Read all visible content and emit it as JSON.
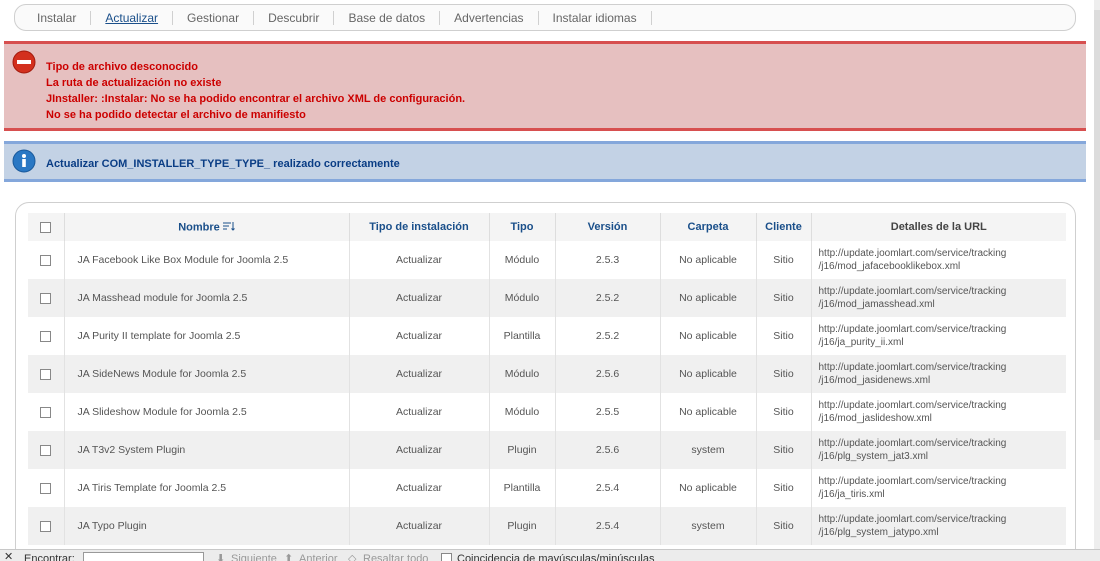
{
  "tabs": [
    "Instalar",
    "Actualizar",
    "Gestionar",
    "Descubrir",
    "Base de datos",
    "Advertencias",
    "Instalar idiomas"
  ],
  "active_tab": "Actualizar",
  "error_messages": [
    "Tipo de archivo desconocido",
    "La ruta de actualización no existe",
    "JInstaller: :Instalar: No se ha podido encontrar el archivo XML de configuración.",
    "No se ha podido detectar el archivo de manifiesto"
  ],
  "info_message": "Actualizar COM_INSTALLER_TYPE_TYPE_ realizado correctamente",
  "table": {
    "headers": {
      "nombre": "Nombre",
      "tipo_instalacion": "Tipo de instalación",
      "tipo": "Tipo",
      "version": "Versión",
      "carpeta": "Carpeta",
      "cliente": "Cliente",
      "detalles_url": "Detalles de la URL"
    },
    "rows": [
      {
        "name": "JA Facebook Like Box Module for Joomla 2.5",
        "install_type": "Actualizar",
        "type": "Módulo",
        "version": "2.5.3",
        "folder": "No aplicable",
        "client": "Sitio",
        "url1": "http://update.joomlart.com/service/tracking",
        "url2": "/j16/mod_jafacebooklikebox.xml"
      },
      {
        "name": "JA Masshead module for Joomla 2.5",
        "install_type": "Actualizar",
        "type": "Módulo",
        "version": "2.5.2",
        "folder": "No aplicable",
        "client": "Sitio",
        "url1": "http://update.joomlart.com/service/tracking",
        "url2": "/j16/mod_jamasshead.xml"
      },
      {
        "name": "JA Purity II template for Joomla 2.5",
        "install_type": "Actualizar",
        "type": "Plantilla",
        "version": "2.5.2",
        "folder": "No aplicable",
        "client": "Sitio",
        "url1": "http://update.joomlart.com/service/tracking",
        "url2": "/j16/ja_purity_ii.xml"
      },
      {
        "name": "JA SideNews Module for Joomla 2.5",
        "install_type": "Actualizar",
        "type": "Módulo",
        "version": "2.5.6",
        "folder": "No aplicable",
        "client": "Sitio",
        "url1": "http://update.joomlart.com/service/tracking",
        "url2": "/j16/mod_jasidenews.xml"
      },
      {
        "name": "JA Slideshow Module for Joomla 2.5",
        "install_type": "Actualizar",
        "type": "Módulo",
        "version": "2.5.5",
        "folder": "No aplicable",
        "client": "Sitio",
        "url1": "http://update.joomlart.com/service/tracking",
        "url2": "/j16/mod_jaslideshow.xml"
      },
      {
        "name": "JA T3v2 System Plugin",
        "install_type": "Actualizar",
        "type": "Plugin",
        "version": "2.5.6",
        "folder": "system",
        "client": "Sitio",
        "url1": "http://update.joomlart.com/service/tracking",
        "url2": "/j16/plg_system_jat3.xml"
      },
      {
        "name": "JA Tiris Template for Joomla 2.5",
        "install_type": "Actualizar",
        "type": "Plantilla",
        "version": "2.5.4",
        "folder": "No aplicable",
        "client": "Sitio",
        "url1": "http://update.joomlart.com/service/tracking",
        "url2": "/j16/ja_tiris.xml"
      },
      {
        "name": "JA Typo Plugin",
        "install_type": "Actualizar",
        "type": "Plugin",
        "version": "2.5.4",
        "folder": "system",
        "client": "Sitio",
        "url1": "http://update.joomlart.com/service/tracking",
        "url2": "/j16/plg_system_jatypo.xml"
      }
    ]
  },
  "findbar": {
    "close": "✕",
    "label": "Encontrar:",
    "next": "Siguiente",
    "prev": "Anterior",
    "highlight": "Resaltar todo",
    "match_case": "Coincidencia de mayúsculas/minúsculas"
  },
  "colors": {
    "error_bg": "#e6c0c0",
    "error_border": "#d74f4f",
    "error_text": "#cc0000",
    "info_bg": "#c3d2e5",
    "info_border": "#84a7db",
    "info_text": "#0a3d85",
    "link_blue": "#1a4f8a"
  },
  "icons": {
    "error": "error-minus-icon",
    "info": "info-icon",
    "sort": "sort-asc-icon",
    "checkbox": "checkbox"
  }
}
